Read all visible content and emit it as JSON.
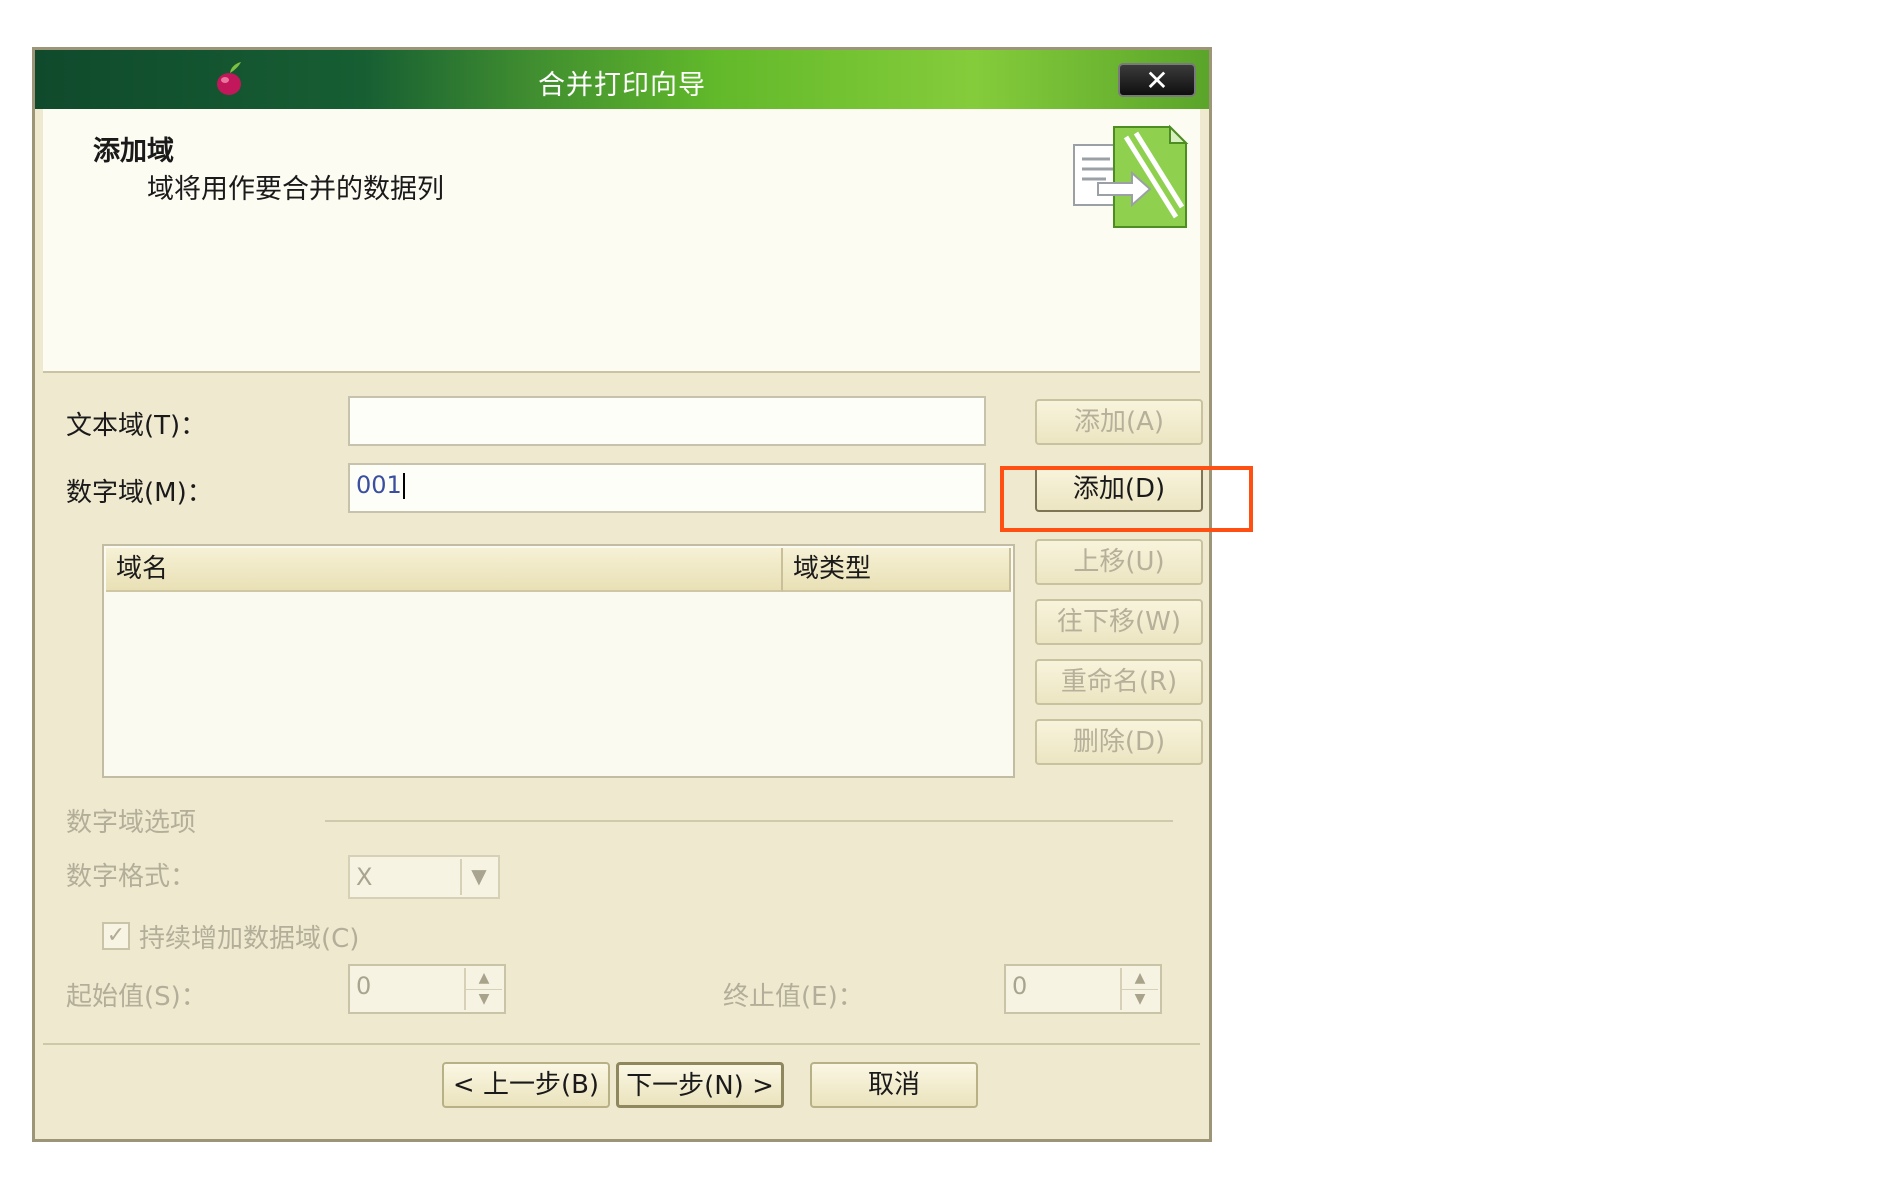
{
  "window": {
    "title": "合并打印向导",
    "close_label": "✕"
  },
  "header": {
    "title": "添加域",
    "subtitle": "域将用作要合并的数据列"
  },
  "fields": {
    "text_field_label": "文本域(T)：",
    "text_field_value": "",
    "number_field_label": "数字域(M)：",
    "number_field_value": "001"
  },
  "buttons": {
    "add_text": "添加(A)",
    "add_number": "添加(D)",
    "move_up": "上移(U)",
    "move_down": "往下移(W)",
    "rename": "重命名(R)",
    "delete": "删除(D)"
  },
  "list": {
    "columns": [
      "域名",
      "域类型"
    ],
    "rows": []
  },
  "number_options": {
    "group_label": "数字域选项",
    "format_label": "数字格式：",
    "format_value": "X",
    "continuous_label": "持续增加数据域(C)",
    "continuous_checked": true,
    "start_label": "起始值(S)：",
    "start_value": "0",
    "end_label": "终止值(E)：",
    "end_value": "0"
  },
  "footer": {
    "back": "< 上一步(B)",
    "next": "下一步(N) >",
    "cancel": "取消"
  },
  "colors": {
    "highlight": "#ff4f12",
    "titlebar_dark": "#0f4a2c",
    "titlebar_light": "#85cc3b"
  }
}
